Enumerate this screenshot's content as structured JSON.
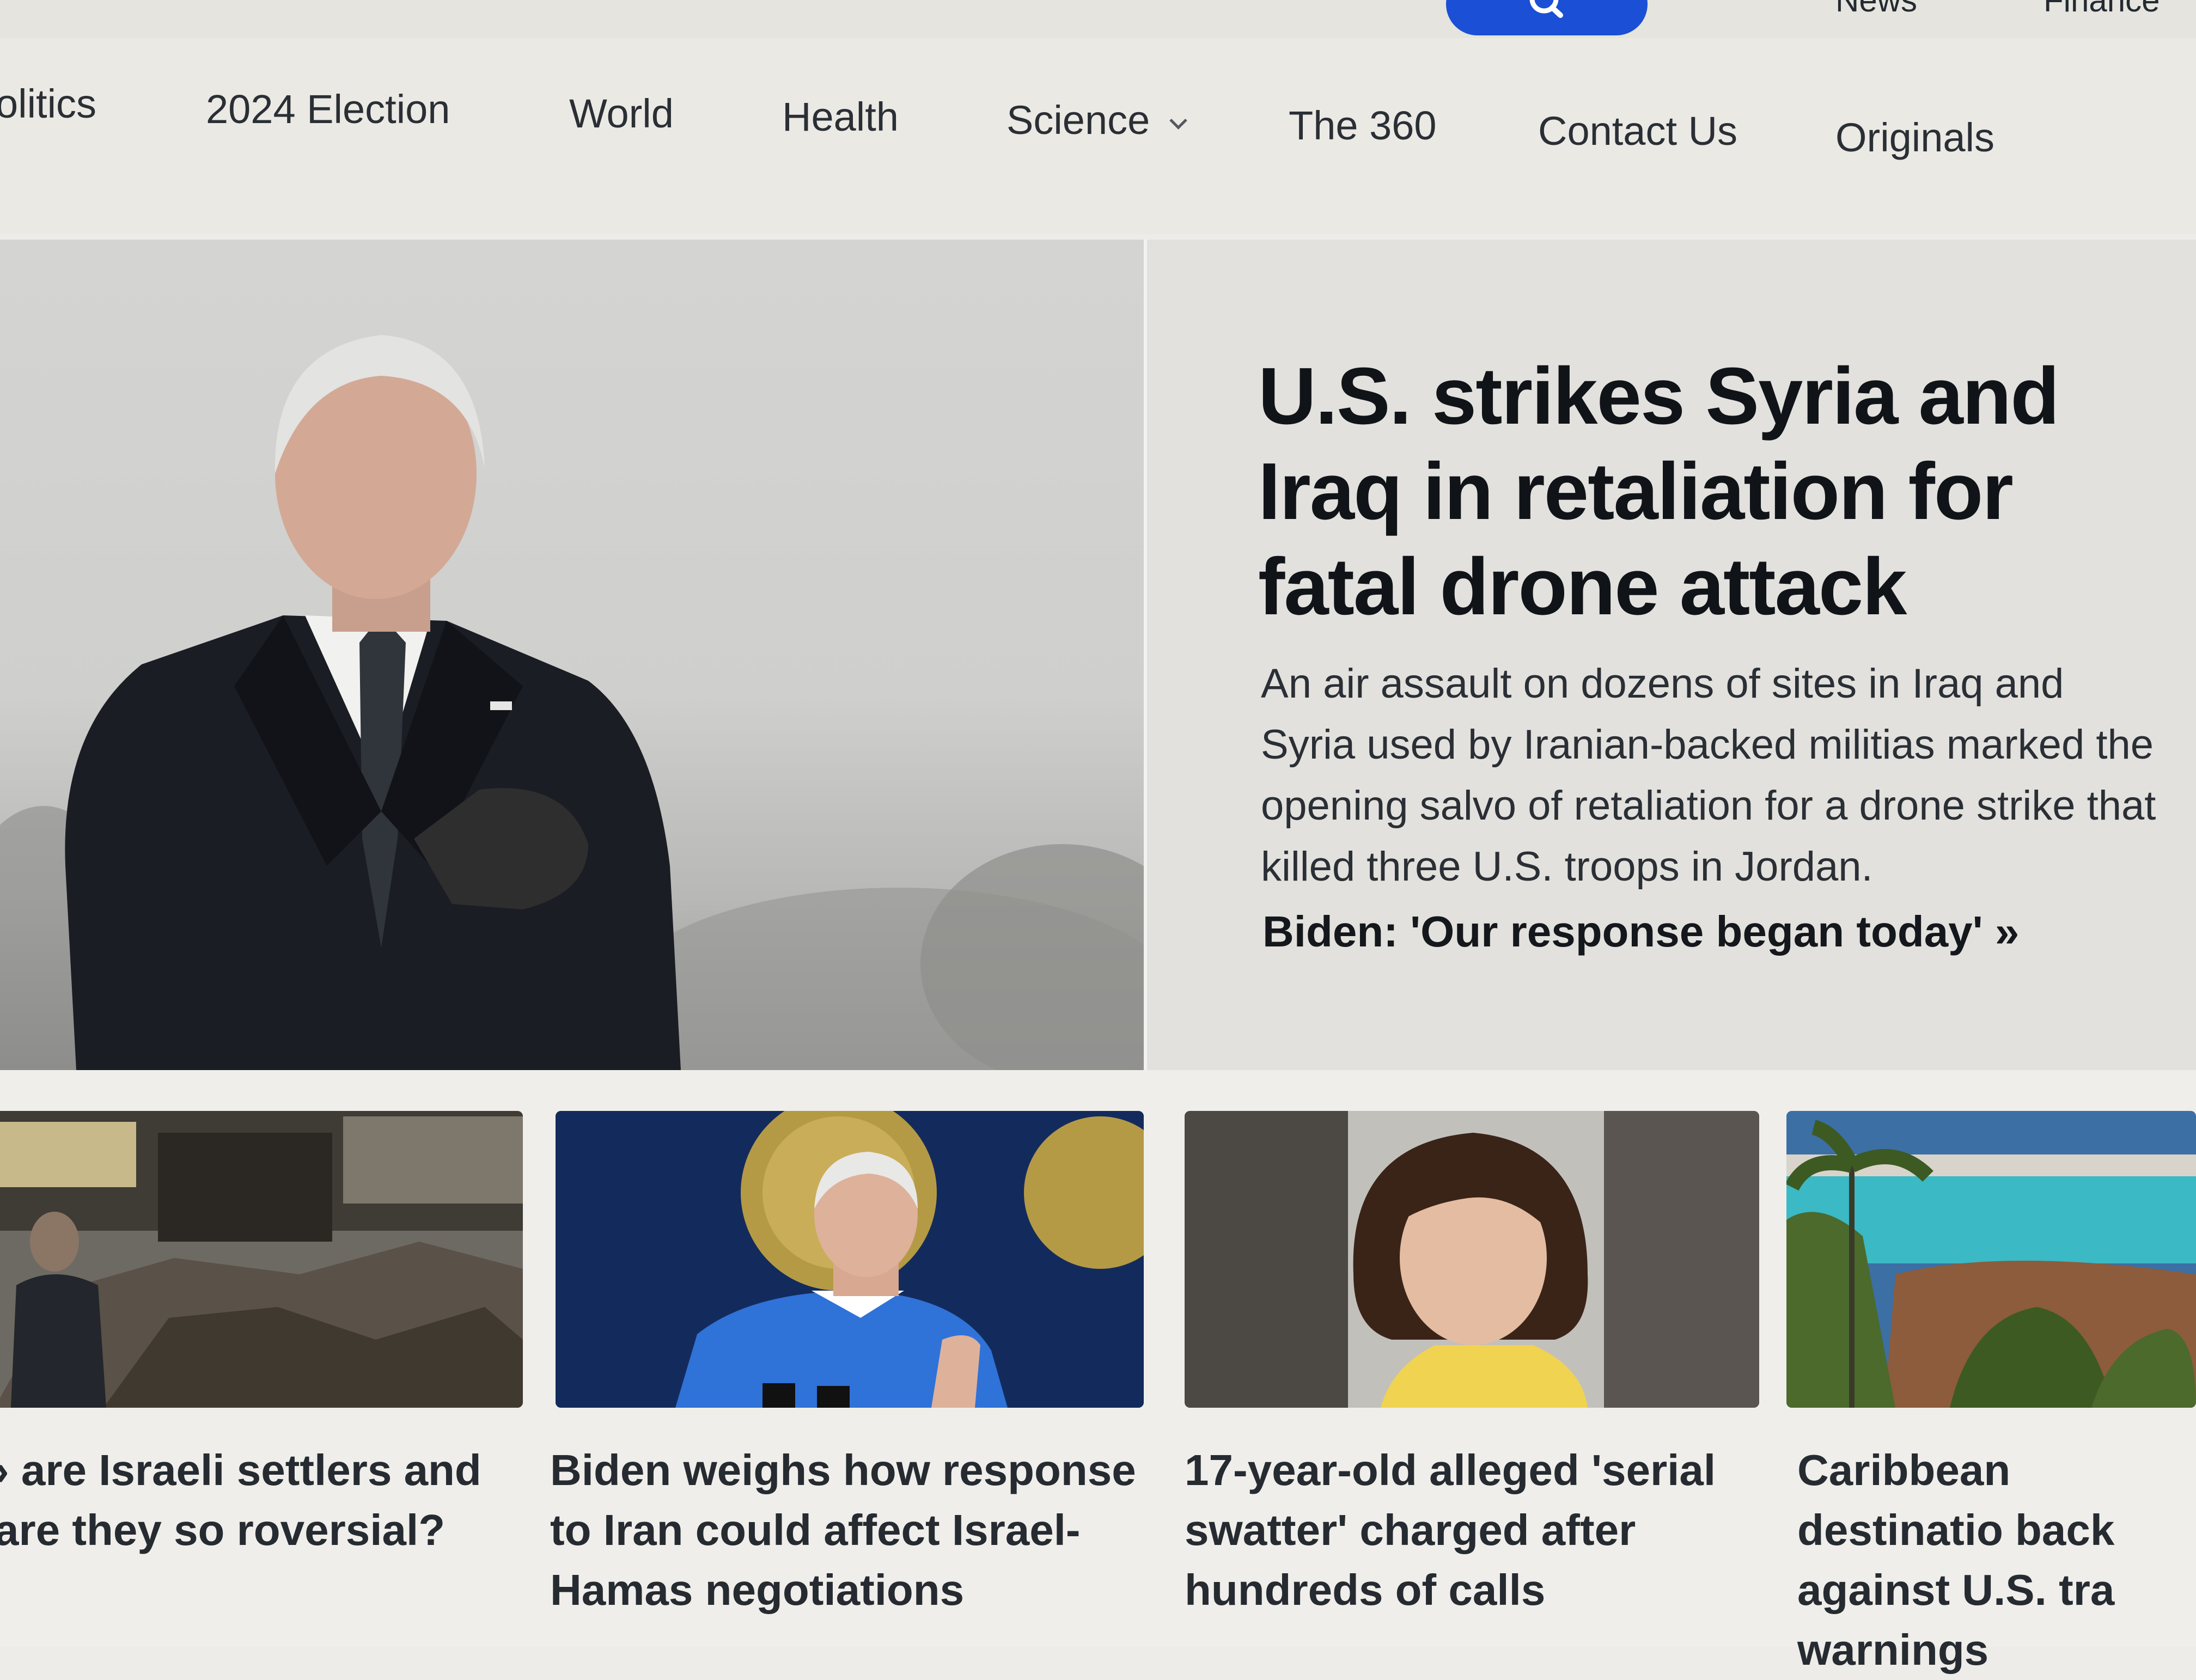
{
  "header": {
    "top_links": [
      "News",
      "Finance"
    ]
  },
  "nav": {
    "items": [
      {
        "label": "olitics"
      },
      {
        "label": "2024 Election"
      },
      {
        "label": "World"
      },
      {
        "label": "Health"
      },
      {
        "label": "Science"
      },
      {
        "label": "The 360"
      },
      {
        "label": "Contact Us"
      },
      {
        "label": "Originals"
      }
    ]
  },
  "hero": {
    "title": "U.S. strikes Syria and Iraq in retaliation for fatal drone attack",
    "summary": "An air assault on dozens of sites in Iraq and Syria used by Iranian-backed militias marked the opening salvo of retaliation for a drone strike that killed three U.S. troops in Jordan.",
    "link": "Biden: 'Our response began today' »"
  },
  "cards": [
    {
      "title": "› are Israeli settlers and are they so roversial?"
    },
    {
      "title": "Biden weighs how response to Iran could affect Israel-Hamas negotiations"
    },
    {
      "title": "17-year-old alleged 'serial swatter' charged after hundreds of calls"
    },
    {
      "title": "Caribbean destinatio back against U.S. tra warnings"
    }
  ],
  "colors": {
    "search_button": "#1a4fd6",
    "background": "#eeece8",
    "headline_text": "#101418"
  }
}
